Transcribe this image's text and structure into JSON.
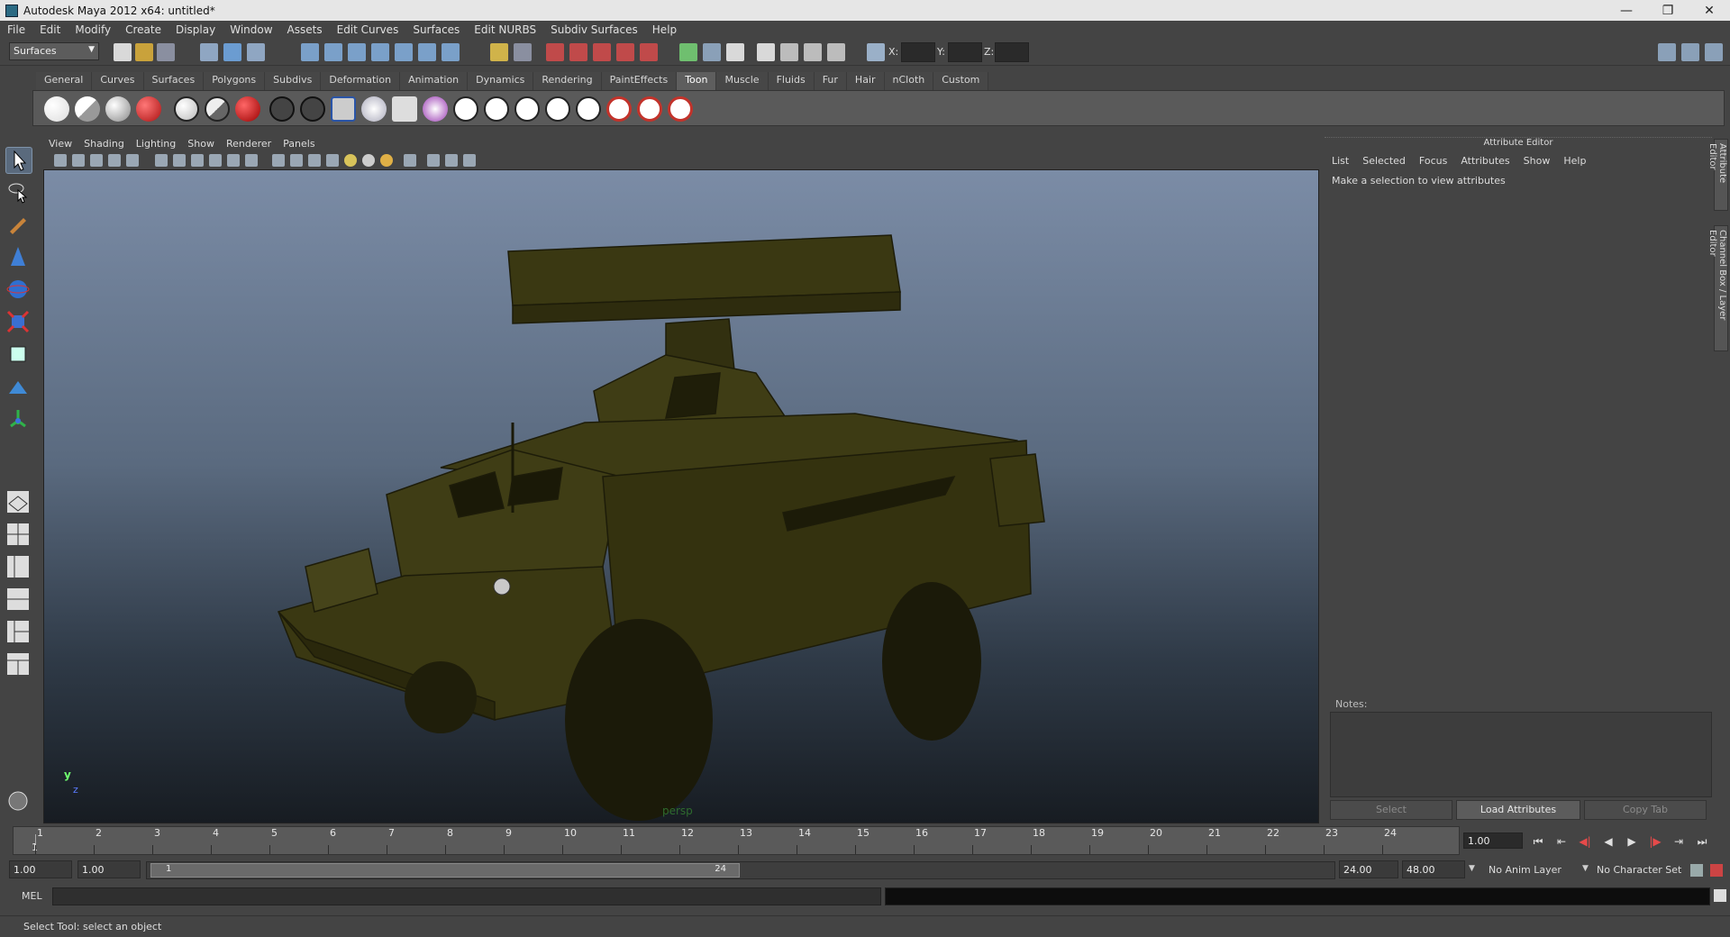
{
  "window": {
    "title": "Autodesk Maya 2012 x64: untitled*",
    "controls": {
      "minimize": "—",
      "restore": "❐",
      "close": "✕"
    }
  },
  "menubar": [
    "File",
    "Edit",
    "Modify",
    "Create",
    "Display",
    "Window",
    "Assets",
    "Edit Curves",
    "Surfaces",
    "Edit NURBS",
    "Subdiv Surfaces",
    "Help"
  ],
  "statusline": {
    "menuset": "Surfaces",
    "x_label": "X:",
    "y_label": "Y:",
    "z_label": "Z:"
  },
  "shelf": {
    "tabs": [
      "General",
      "Curves",
      "Surfaces",
      "Polygons",
      "Subdivs",
      "Deformation",
      "Animation",
      "Dynamics",
      "Rendering",
      "PaintEffects",
      "Toon",
      "Muscle",
      "Fluids",
      "Fur",
      "Hair",
      "nCloth",
      "Custom"
    ],
    "active_tab": "Toon"
  },
  "viewport": {
    "menu": [
      "View",
      "Shading",
      "Lighting",
      "Show",
      "Renderer",
      "Panels"
    ],
    "camera_label": "persp",
    "axis_y": "y",
    "axis_z": "z"
  },
  "attribute_editor": {
    "title": "Attribute Editor",
    "menu": [
      "List",
      "Selected",
      "Focus",
      "Attributes",
      "Show",
      "Help"
    ],
    "hint": "Make a selection to view attributes",
    "notes_label": "Notes:",
    "buttons": {
      "select": "Select",
      "load": "Load Attributes",
      "copy_tab": "Copy Tab"
    }
  },
  "side_tabs": [
    "Attribute Editor",
    "Channel Box / Layer Editor"
  ],
  "timeslider": {
    "ticks": [
      "1",
      "2",
      "3",
      "4",
      "5",
      "6",
      "7",
      "8",
      "9",
      "10",
      "11",
      "12",
      "13",
      "14",
      "15",
      "16",
      "17",
      "18",
      "19",
      "20",
      "21",
      "22",
      "23",
      "24"
    ],
    "current_frame_marker": "1",
    "current_frame_field": "1.00"
  },
  "playback": [
    "⏮",
    "⇤",
    "◀|",
    "◀",
    "▶",
    "|▶",
    "⇥",
    "⏭"
  ],
  "rangeslider": {
    "start_time": "1.00",
    "playback_start": "1.00",
    "range_start_label": "1",
    "range_end_label": "24",
    "playback_end": "24.00",
    "end_time": "48.00",
    "anim_layer": "No Anim Layer",
    "character_set": "No Character Set"
  },
  "cmdline": {
    "label": "MEL"
  },
  "helpline": {
    "text": "Select Tool: select an object"
  },
  "colors": {
    "ui_bg": "#444444",
    "viewport_top": "#7b8ca6",
    "viewport_bottom": "#171c22",
    "model": "#3c3a14"
  }
}
